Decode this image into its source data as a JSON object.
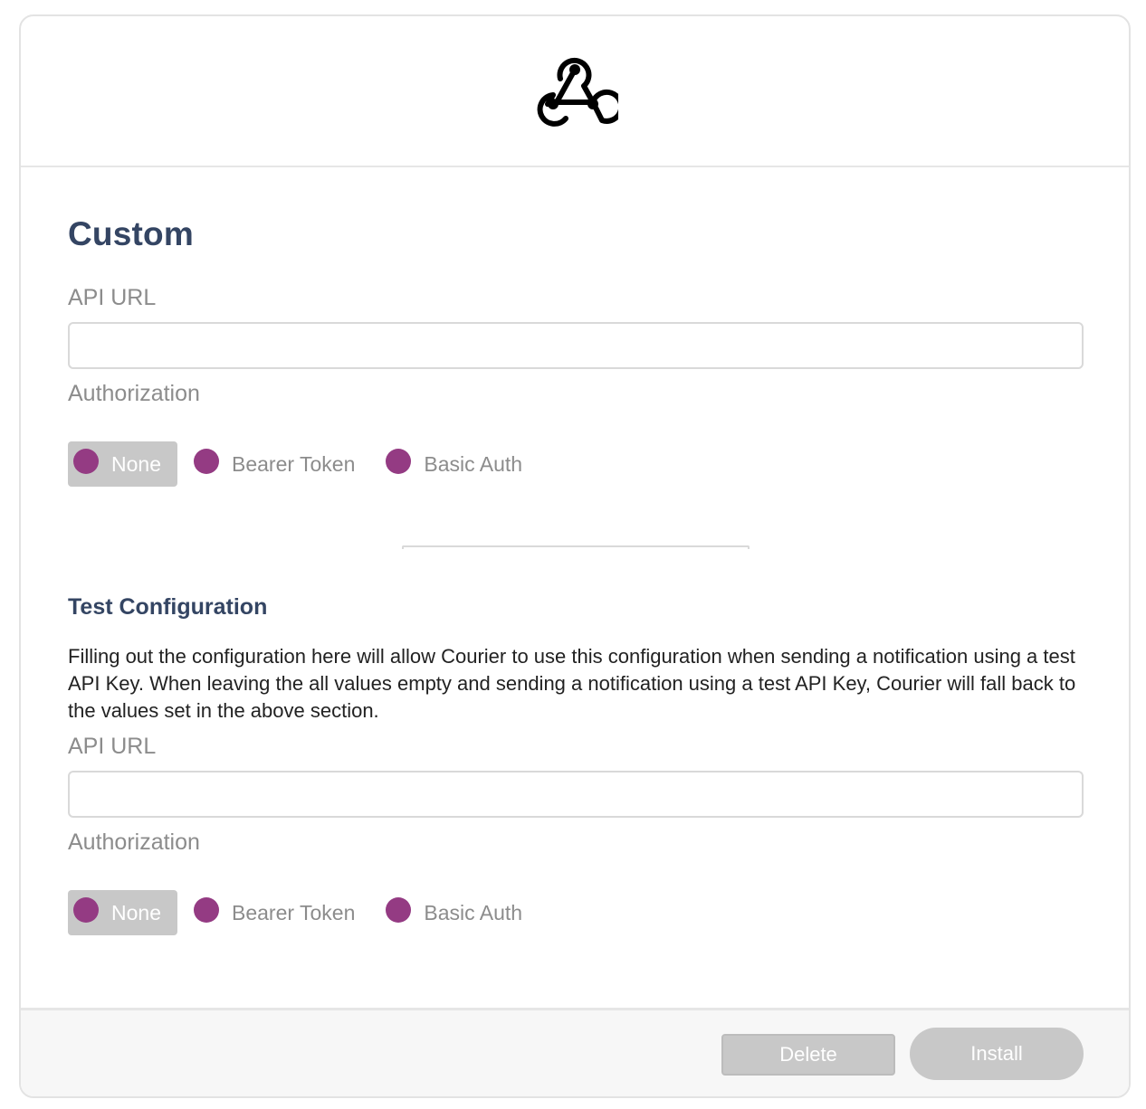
{
  "header": {
    "logo_icon": "webhook-icon"
  },
  "main": {
    "title": "Custom",
    "api_url": {
      "label": "API URL",
      "value": "",
      "placeholder": ""
    },
    "authorization": {
      "label": "Authorization",
      "options": [
        "None",
        "Bearer Token",
        "Basic Auth"
      ],
      "selected": "None"
    }
  },
  "test_configuration": {
    "title": "Test Configuration",
    "description": "Filling out the configuration here will allow Courier to use this configuration when sending a notification using a test API Key. When leaving the all values empty and sending a notification using a test API Key, Courier will fall back to the values set in the above section.",
    "api_url": {
      "label": "API URL",
      "value": "",
      "placeholder": ""
    },
    "authorization": {
      "label": "Authorization",
      "options": [
        "None",
        "Bearer Token",
        "Basic Auth"
      ],
      "selected": "None"
    }
  },
  "footer": {
    "delete_label": "Delete",
    "install_label": "Install"
  },
  "colors": {
    "radio_accent": "#943b83",
    "heading": "#344563",
    "button_disabled": "#c8c8c8"
  }
}
